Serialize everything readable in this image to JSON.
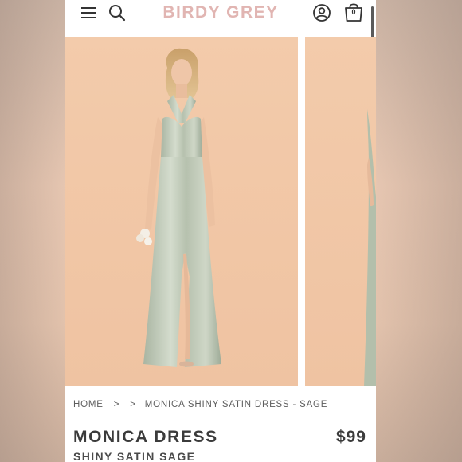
{
  "header": {
    "brand": "BIRDY GREY",
    "bag_count": "0",
    "menu_icon": "hamburger-menu-icon",
    "search_icon": "search-icon",
    "account_icon": "account-icon",
    "bag_icon": "shopping-bag-icon"
  },
  "gallery": {
    "images": [
      {
        "alt": "model wearing sage satin halter dress"
      },
      {
        "alt": "model wearing sage satin halter dress, side view"
      }
    ]
  },
  "breadcrumb": {
    "items": [
      "HOME",
      "MONICA SHINY SATIN DRESS - SAGE"
    ],
    "separator": ">"
  },
  "product": {
    "name": "MONICA DRESS",
    "price": "$99",
    "variant": "SHINY SATIN SAGE"
  },
  "colors": {
    "brand": "#e1b5b2",
    "backdrop": "#f2c9a9",
    "dress": "#b9c4b2",
    "text": "#3b3b3b"
  }
}
